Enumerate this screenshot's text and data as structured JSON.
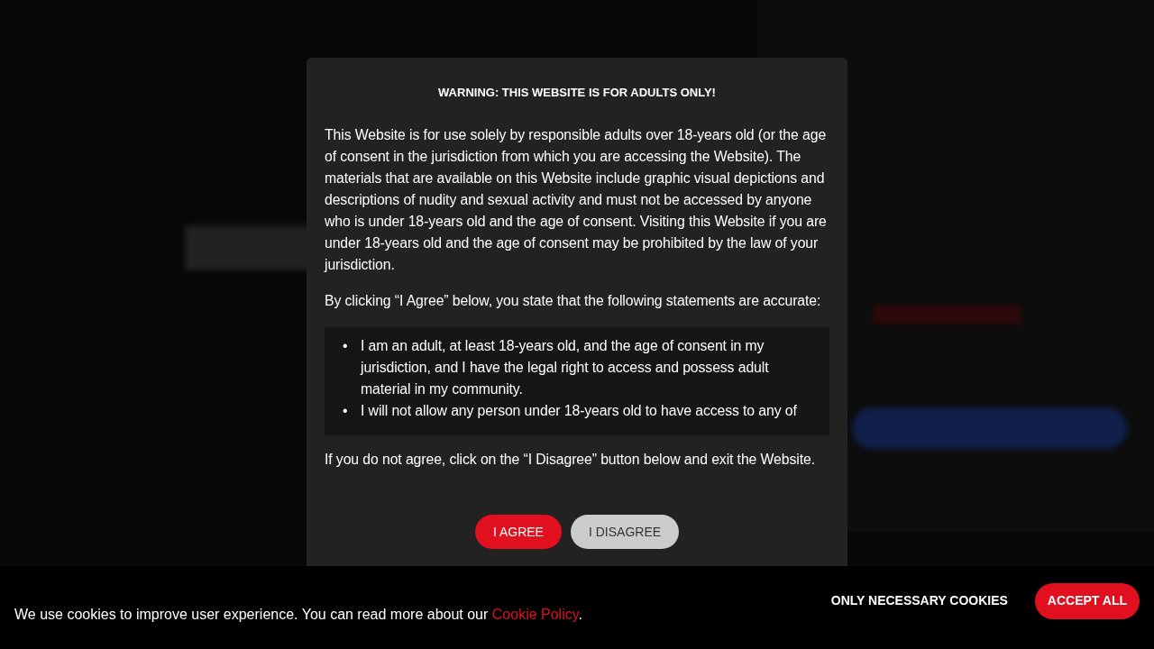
{
  "age_gate": {
    "title": "WARNING: THIS WEBSITE IS FOR ADULTS ONLY!",
    "paragraphs": [
      "This Website is for use solely by responsible adults over 18-years old (or the age of consent in the jurisdiction from which you are accessing the Website). The materials that are available on this Website include graphic visual depictions and descriptions of nudity and sexual activity and must not be accessed by anyone who is under 18-years old and the age of consent. Visiting this Website if you are under 18-years old and the age of consent may be prohibited by the law of your jurisdiction.",
      "By clicking “I Agree” below, you state that the following statements are accurate:"
    ],
    "statements": [
      {
        "marker": "•",
        "text": "I am an adult, at least 18-years old, and the age of consent in my jurisdiction, and I have the legal right to access and possess adult material in my community."
      },
      {
        "marker": "•",
        "text": "I will not allow any person under 18-years old to have access to any of"
      }
    ],
    "footer_text": "If you do not agree, click on the “I Disagree” button below and exit the Website.",
    "buttons": [
      {
        "label": "I AGREE",
        "kind": "primary"
      },
      {
        "label": "I DISAGREE",
        "kind": "secondary"
      }
    ]
  },
  "cookie_bar": {
    "text_before": "We use cookies to improve user experience. You can read more about our ",
    "link": "Cookie Policy",
    "text_after": ".",
    "buttons": [
      {
        "label": "ONLY NECESSARY COOKIES",
        "kind": "text"
      },
      {
        "label": "ACCEPT ALL",
        "kind": "primary"
      }
    ]
  }
}
